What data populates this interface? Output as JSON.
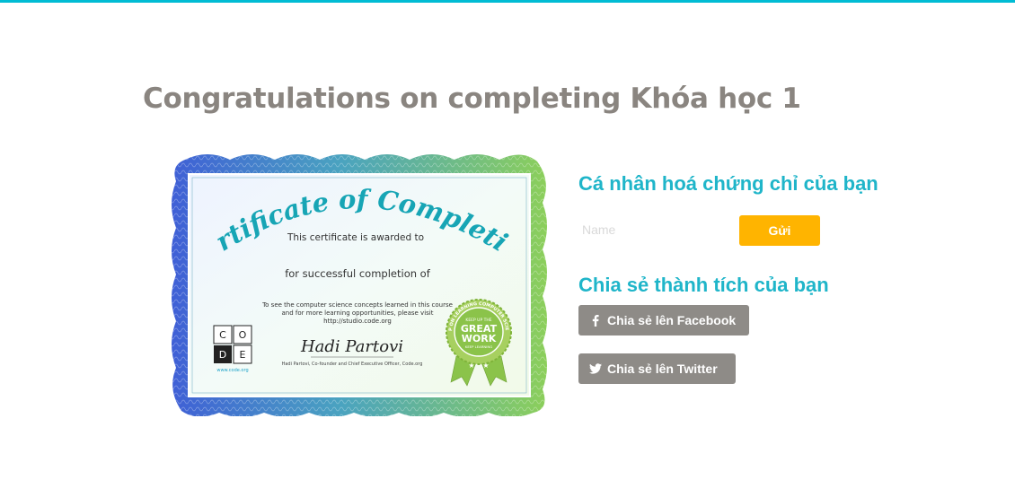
{
  "page": {
    "title": "Congratulations on completing Khóa học 1"
  },
  "certificate": {
    "heading": "Certificate of Completion",
    "awarded_text": "This certificate is awarded to",
    "completion_text": "for successful completion of",
    "info_line1": "To see the computer science concepts learned in this course",
    "info_line2": "and for more learning opportunities, please visit",
    "info_line3": "http://studio.code.org",
    "logo_letters": [
      "C",
      "O",
      "D",
      "E"
    ],
    "logo_url": "www.code.org",
    "signature": "Hadi Partovi",
    "signer_line": "Hadi Partovi, Co-founder and Chief Executive Officer, Code.org",
    "badge_ring_text": "KEEP ON LEARNING COMPUTER SCIENCE",
    "badge_top": "KEEP UP THE",
    "badge_main1": "GREAT",
    "badge_main2": "WORK",
    "badge_bottom": "KEEP LEARNING"
  },
  "personalize": {
    "heading": "Cá nhân hoá chứng chỉ của bạn",
    "name_placeholder": "Name",
    "name_value": "",
    "submit_label": "Gửi"
  },
  "share": {
    "heading": "Chia sẻ thành tích của bạn",
    "facebook_label": "Chia sẻ lên Facebook",
    "twitter_label": "Chia sẻ lên Twitter"
  },
  "colors": {
    "accent": "#1fb5c9",
    "topbar": "#00bcd4",
    "submit": "#ffb400",
    "share_button": "#8e8b87",
    "title": "#8a8580"
  },
  "icons": {
    "facebook": "facebook-icon",
    "twitter": "twitter-icon"
  }
}
